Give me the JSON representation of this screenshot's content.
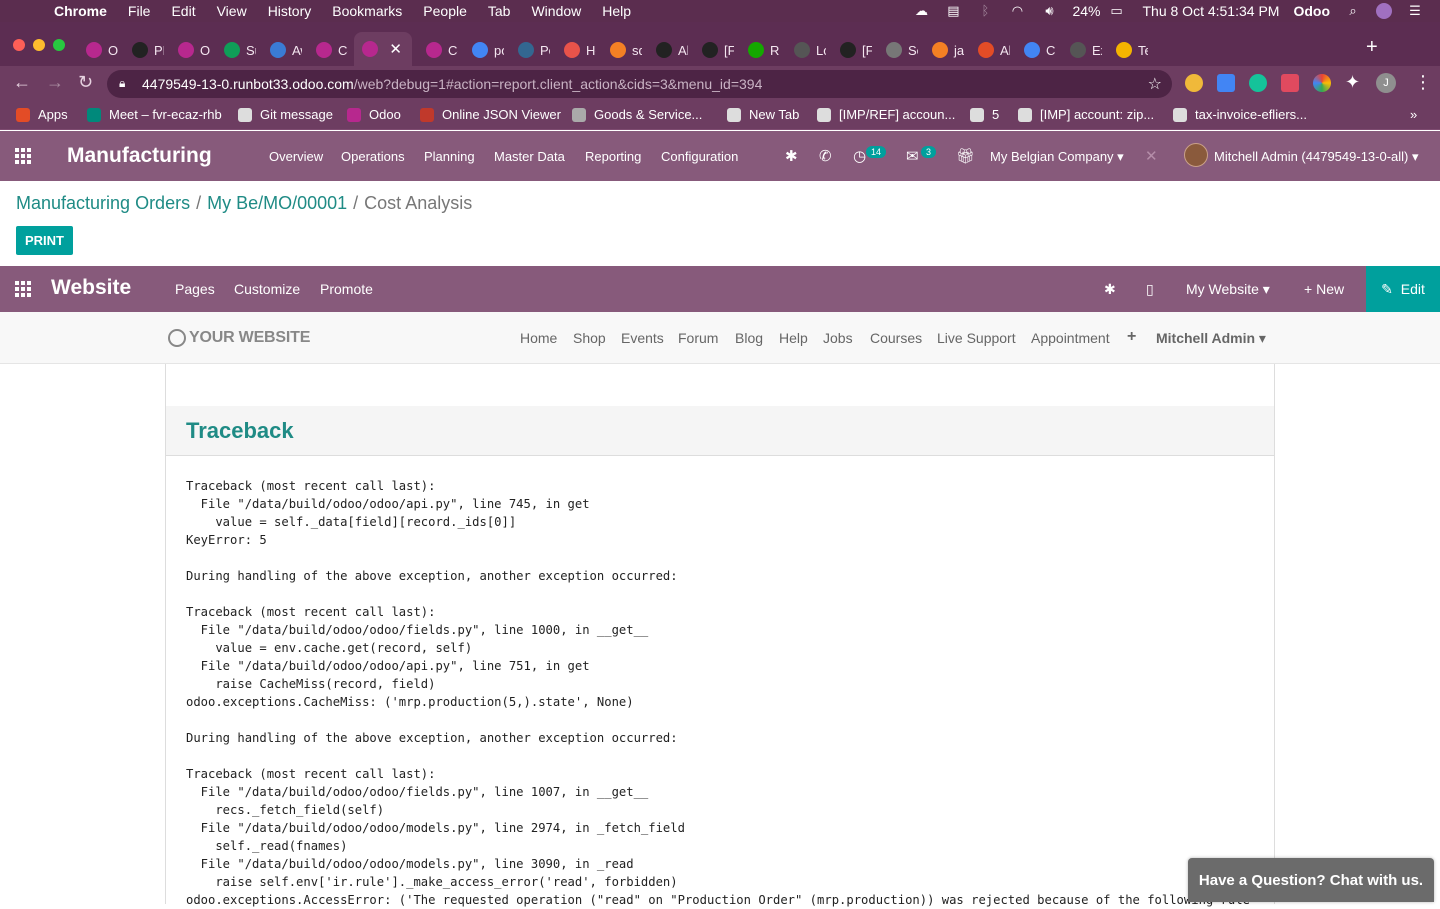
{
  "mac_menu": {
    "app": "Chrome",
    "items": [
      "File",
      "Edit",
      "View",
      "History",
      "Bookmarks",
      "People",
      "Tab",
      "Window",
      "Help"
    ],
    "battery": "24%",
    "clock": "Thu 8 Oct  4:51:34 PM",
    "user_app": "Odoo"
  },
  "tabs": [
    {
      "label": "Od",
      "icon": "odoo-icon",
      "color": "#b7288e"
    },
    {
      "label": "PL",
      "icon": "github-icon",
      "color": "#222"
    },
    {
      "label": "Od",
      "icon": "odoo-icon",
      "color": "#b7288e"
    },
    {
      "label": "Su",
      "icon": "sheets-icon",
      "color": "#0f9d58"
    },
    {
      "label": "Aw",
      "icon": "chromium-icon",
      "color": "#3a7bd5"
    },
    {
      "label": "Co",
      "icon": "odoo-icon",
      "color": "#b7288e"
    },
    {
      "label": "",
      "icon": "odoo-icon",
      "color": "#b7288e",
      "active": true
    },
    {
      "label": "Co",
      "icon": "odoo-icon",
      "color": "#b7288e"
    },
    {
      "label": "po",
      "icon": "google-icon",
      "color": "#4285f4"
    },
    {
      "label": "Po",
      "icon": "postgres-icon",
      "color": "#336791"
    },
    {
      "label": "Ho",
      "icon": "chat-icon",
      "color": "#e8534a"
    },
    {
      "label": "sq",
      "icon": "stackoverflow-icon",
      "color": "#f48024"
    },
    {
      "label": "Ab",
      "icon": "github-icon",
      "color": "#222"
    },
    {
      "label": "[FI",
      "icon": "github-icon",
      "color": "#222"
    },
    {
      "label": "Ru",
      "icon": "upwork-icon",
      "color": "#14a800"
    },
    {
      "label": "Lo",
      "icon": "doc-icon",
      "color": "#555"
    },
    {
      "label": "[FI",
      "icon": "github-icon",
      "color": "#222"
    },
    {
      "label": "Se",
      "icon": "gear-icon",
      "color": "#777"
    },
    {
      "label": "jav",
      "icon": "stackoverflow-icon",
      "color": "#f48024"
    },
    {
      "label": "All",
      "icon": "calendar-icon",
      "color": "#e34c26"
    },
    {
      "label": "Ch",
      "icon": "chrome-icon",
      "color": "#4285f4"
    },
    {
      "label": "Ex",
      "icon": "flask-icon",
      "color": "#555"
    },
    {
      "label": "Te",
      "icon": "circle-icon",
      "color": "#f4b400"
    }
  ],
  "address": {
    "host": "4479549-13-0.runbot33.odoo.com",
    "path": "/web?debug=1#action=report.client_action&cids=3&menu_id=394"
  },
  "bookmarks": [
    {
      "label": "Apps",
      "icon": "apps-icon",
      "color": "#e34c26"
    },
    {
      "label": "Meet – fvr-ecaz-rhb",
      "icon": "meet-icon",
      "color": "#00897b"
    },
    {
      "label": "Git message",
      "icon": "github-icon",
      "color": "#ddd"
    },
    {
      "label": "Odoo",
      "icon": "odoo-icon",
      "color": "#b7288e"
    },
    {
      "label": "Online JSON Viewer",
      "icon": "json-icon",
      "color": "#c0392b"
    },
    {
      "label": "Goods & Service...",
      "icon": "gst-icon",
      "color": "#aaa"
    },
    {
      "label": "New Tab",
      "icon": "globe-icon",
      "color": "#ddd"
    },
    {
      "label": "[IMP/REF] accoun...",
      "icon": "github-icon",
      "color": "#ddd"
    },
    {
      "label": "5",
      "icon": "github-icon",
      "color": "#ddd"
    },
    {
      "label": "[IMP] account: zip...",
      "icon": "github-icon",
      "color": "#ddd"
    },
    {
      "label": "tax-invoice-efliers...",
      "icon": "globe-icon",
      "color": "#ddd"
    }
  ],
  "odoo_nav": {
    "app": "Manufacturing",
    "menus": [
      "Overview",
      "Operations",
      "Planning",
      "Master Data",
      "Reporting",
      "Configuration"
    ],
    "activity_count": "14",
    "message_count": "3",
    "company": "My Belgian Company",
    "user": "Mitchell Admin (4479549-13-0-all)"
  },
  "breadcrumb": {
    "root": "Manufacturing Orders",
    "record": "My Be/MO/00001",
    "current": "Cost Analysis"
  },
  "print_label": "PRINT",
  "website_nav": {
    "brand": "Website",
    "items": [
      "Pages",
      "Customize",
      "Promote"
    ],
    "website": "My Website",
    "new_label": "New",
    "edit_label": "Edit"
  },
  "site_header": {
    "logo": "YOUR WEBSITE",
    "links": [
      "Home",
      "Shop",
      "Events",
      "Forum",
      "Blog",
      "Help",
      "Jobs",
      "Courses",
      "Live Support",
      "Appointment"
    ],
    "user": "Mitchell Admin"
  },
  "traceback": {
    "title": "Traceback",
    "lines": [
      "Traceback (most recent call last):",
      "  File \"/data/build/odoo/odoo/api.py\", line 745, in get",
      "    value = self._data[field][record._ids[0]]",
      "KeyError: 5",
      "",
      "During handling of the above exception, another exception occurred:",
      "",
      "Traceback (most recent call last):",
      "  File \"/data/build/odoo/odoo/fields.py\", line 1000, in __get__",
      "    value = env.cache.get(record, self)",
      "  File \"/data/build/odoo/odoo/api.py\", line 751, in get",
      "    raise CacheMiss(record, field)",
      "odoo.exceptions.CacheMiss: ('mrp.production(5,).state', None)",
      "",
      "During handling of the above exception, another exception occurred:",
      "",
      "Traceback (most recent call last):",
      "  File \"/data/build/odoo/odoo/fields.py\", line 1007, in __get__",
      "    recs._fetch_field(self)",
      "  File \"/data/build/odoo/odoo/models.py\", line 2974, in _fetch_field",
      "    self._read(fnames)",
      "  File \"/data/build/odoo/odoo/models.py\", line 3090, in _read",
      "    raise self.env['ir.rule']._make_access_error('read', forbidden)",
      "odoo.exceptions.AccessError: ('The requested operation (\"read\" on \"Production Order\" (mrp.production)) was rejected because of the following rule"
    ]
  },
  "chat_label": "Have a Question? Chat with us.",
  "colors": {
    "odoo_purple": "#875a7b",
    "teal": "#00a09d",
    "chrome_frame": "#5c2d52"
  }
}
